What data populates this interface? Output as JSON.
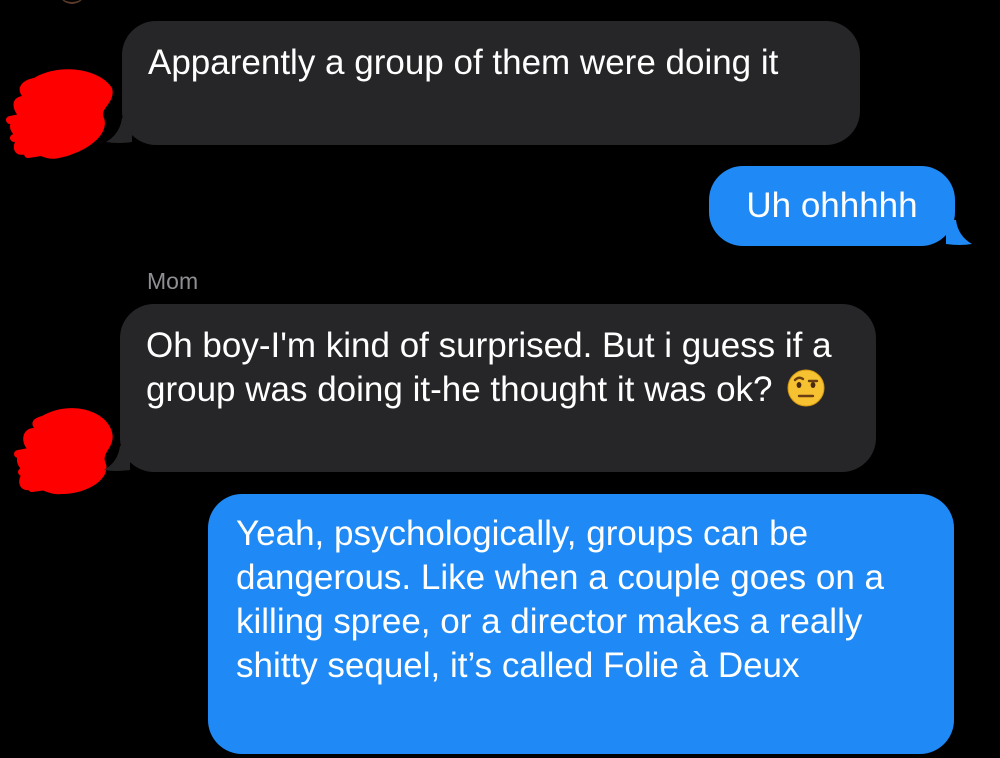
{
  "conversation": {
    "messages": [
      {
        "direction": "incoming",
        "sender": "",
        "text": "Apparently a group of them were doing it",
        "avatar_redacted": true
      },
      {
        "direction": "outgoing",
        "text": "Uh ohhhhh"
      },
      {
        "direction": "incoming",
        "sender": "Mom",
        "text": "Oh boy-I'm kind of surprised.  But i guess if a group was doing it-he thought it was ok?",
        "emoji": "face-with-raised-eyebrow",
        "avatar_redacted": true
      },
      {
        "direction": "outgoing",
        "text": "Yeah, psychologically, groups can be dangerous. Like when a couple goes on a killing spree, or a director makes a really shitty sequel, it’s called Folie à Deux"
      }
    ]
  },
  "colors": {
    "background": "#000000",
    "incoming_bubble": "#262628",
    "outgoing_bubble": "#1f8af5",
    "sender_label": "#8e8e93",
    "redaction": "#ff0000"
  }
}
